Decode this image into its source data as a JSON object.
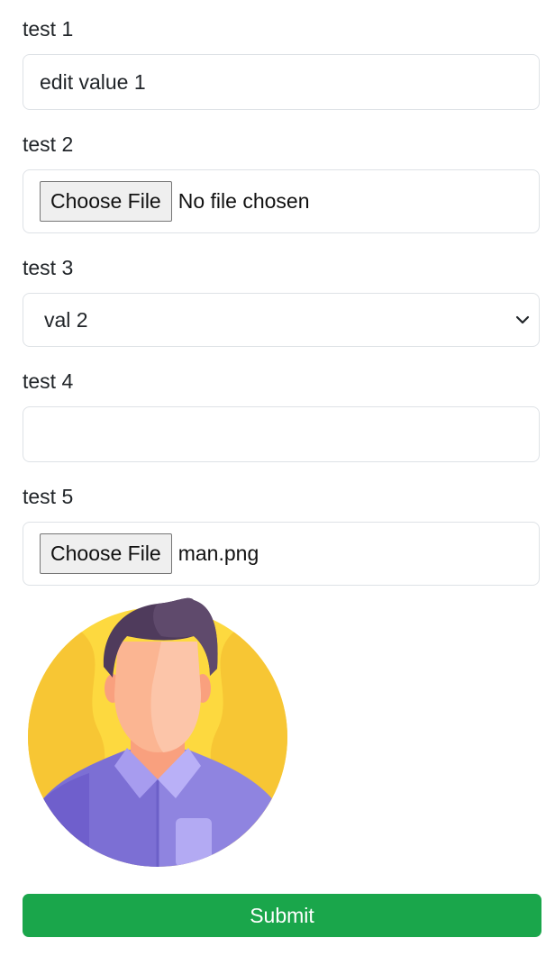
{
  "fields": [
    {
      "label": "test 1",
      "type": "text",
      "value": "edit value 1"
    },
    {
      "label": "test 2",
      "type": "file",
      "button_label": "Choose File",
      "file_status": "No file chosen"
    },
    {
      "label": "test 3",
      "type": "select",
      "selected": "val 2"
    },
    {
      "label": "test 4",
      "type": "text",
      "value": ""
    },
    {
      "label": "test 5",
      "type": "file",
      "button_label": "Choose File",
      "file_status": "man.png"
    }
  ],
  "preview": {
    "icon": "man-avatar-icon"
  },
  "submit": {
    "label": "Submit"
  },
  "colors": {
    "submit_bg": "#1aa64b",
    "field_border": "#dee2e6",
    "text": "#212529"
  }
}
